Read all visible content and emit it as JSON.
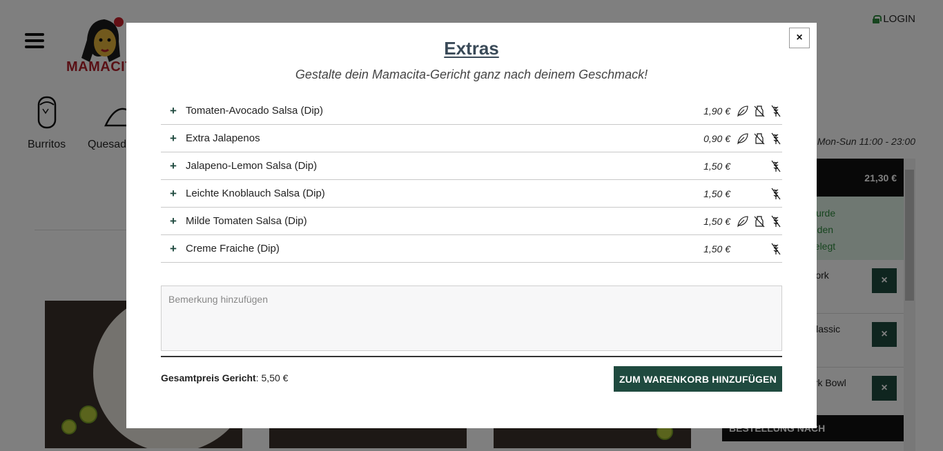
{
  "header": {
    "logo_text": "MAMACITA",
    "login_label": "LOGIN"
  },
  "categories": [
    {
      "label": "Burritos",
      "icon": "burrito-icon"
    },
    {
      "label": "Quesadillas",
      "icon": "quesadilla-icon"
    }
  ],
  "opening_hours": "Mon-Sun 11:00 - 23:00",
  "cart": {
    "total": "21,30 €",
    "note_lines": [
      "wurde",
      "n den",
      "gelegt"
    ],
    "items": [
      {
        "label": "Pork",
        "remove": "×"
      },
      {
        "label": "Classic",
        "remove": "×"
      },
      {
        "label": "ork Bowl",
        "remove": "×"
      }
    ],
    "footer": "BESTELLUNG NACH"
  },
  "modal": {
    "close": "×",
    "title": "Extras",
    "subtitle": "Gestalte dein Mamacita-Gericht ganz nach deinem Geschmack!",
    "extras": [
      {
        "plus": "+",
        "name": "Tomaten-Avocado Salsa (Dip)",
        "price": "1,90 €",
        "vegan": true,
        "lactose_free": true,
        "gluten_free": true
      },
      {
        "plus": "+",
        "name": "Extra Jalapenos",
        "price": "0,90 €",
        "vegan": true,
        "lactose_free": true,
        "gluten_free": true
      },
      {
        "plus": "+",
        "name": "Jalapeno-Lemon Salsa (Dip)",
        "price": "1,50 €",
        "vegan": false,
        "lactose_free": false,
        "gluten_free": true
      },
      {
        "plus": "+",
        "name": "Leichte Knoblauch Salsa (Dip)",
        "price": "1,50 €",
        "vegan": false,
        "lactose_free": false,
        "gluten_free": true
      },
      {
        "plus": "+",
        "name": "Milde Tomaten Salsa (Dip)",
        "price": "1,50 €",
        "vegan": true,
        "lactose_free": true,
        "gluten_free": true
      },
      {
        "plus": "+",
        "name": "Creme Fraiche (Dip)",
        "price": "1,50 €",
        "vegan": false,
        "lactose_free": false,
        "gluten_free": true
      }
    ],
    "remark_placeholder": "Bemerkung hinzufügen",
    "total_label": "Gesamtpreis Gericht",
    "total_value": ": 5,50 €",
    "add_button": "ZUM WARENKORB HINZUFÜGEN"
  },
  "colors": {
    "accent": "#1f4a3f",
    "title": "#3a4a58",
    "brand_red": "#b3202a"
  }
}
